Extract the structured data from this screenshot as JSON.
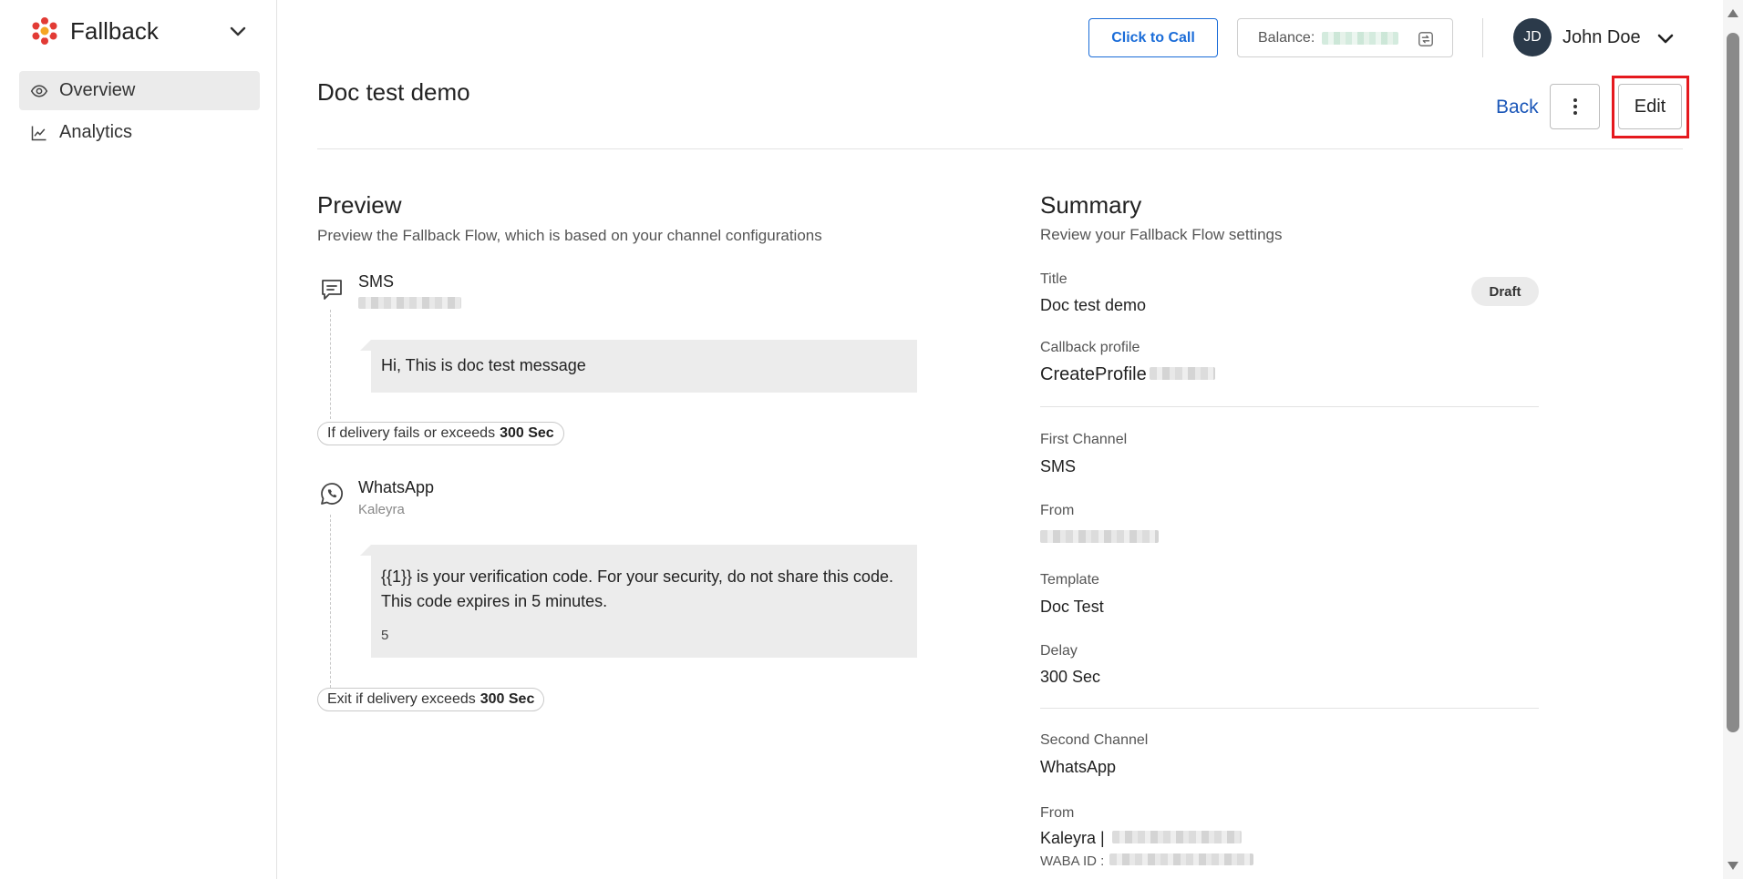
{
  "sidebar": {
    "brand": {
      "name": "Fallback",
      "logo_color": "#e23b35"
    },
    "items": [
      {
        "label": "Overview",
        "icon": "eye-icon",
        "active": true
      },
      {
        "label": "Analytics",
        "icon": "line-chart-icon",
        "active": false
      }
    ]
  },
  "header": {
    "click_to_call_label": "Click to Call",
    "balance_label": "Balance:",
    "user_initials": "JD",
    "user_name": "John Doe",
    "accent_color": "#1a6cd8"
  },
  "page": {
    "title": "Doc test demo",
    "back_label": "Back",
    "edit_label": "Edit"
  },
  "preview": {
    "title": "Preview",
    "subtitle": "Preview the Fallback Flow, which is based on your channel configurations",
    "channels": [
      {
        "name": "SMS",
        "icon": "message-icon",
        "message": "Hi, This is doc test message"
      },
      {
        "name": "WhatsApp",
        "icon": "whatsapp-icon",
        "sender": "Kaleyra",
        "message_line1": "{{1}} is your verification code. For your security, do not share this code.",
        "message_line2": "This code expires in 5 minutes.",
        "message_footer": "5"
      }
    ],
    "fail_prefix": "If delivery fails or exceeds",
    "fail_value": "300 Sec",
    "exit_prefix": "Exit if delivery exceeds",
    "exit_value": "300 Sec"
  },
  "summary": {
    "title": "Summary",
    "subtitle": "Review your Fallback Flow settings",
    "status_badge": "Draft",
    "title_label": "Title",
    "title_value": "Doc test demo",
    "callback_label": "Callback profile",
    "callback_value": "CreateProfile",
    "first_channel_label": "First Channel",
    "first_channel_value": "SMS",
    "from_label": "From",
    "template_label": "Template",
    "template_value": "Doc Test",
    "delay_label": "Delay",
    "delay_value": "300 Sec",
    "second_channel_label": "Second Channel",
    "second_channel_value": "WhatsApp",
    "from2_label": "From",
    "from2_value": "Kaleyra |",
    "waba_label": "WABA ID :"
  }
}
